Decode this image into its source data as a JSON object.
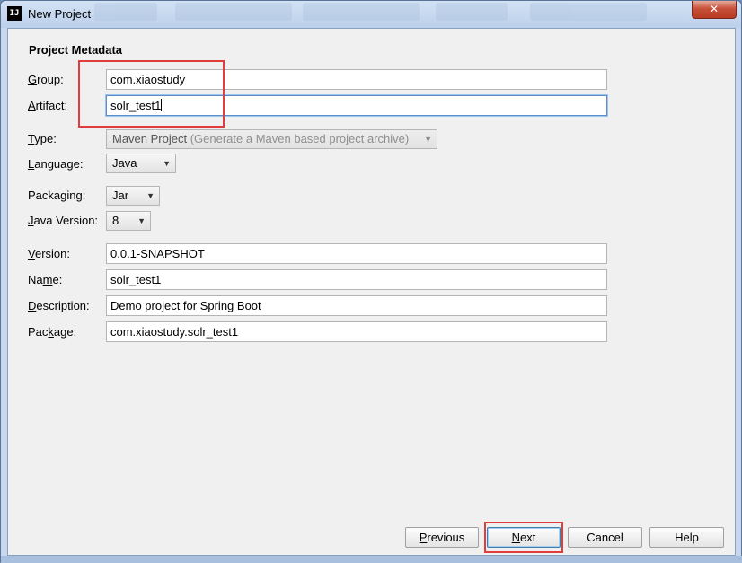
{
  "window": {
    "title": "New Project",
    "app_icon": "IJ",
    "close_glyph": "✕"
  },
  "section": {
    "title": "Project Metadata"
  },
  "fields": {
    "group": {
      "label_pre": "",
      "label_u": "G",
      "label_post": "roup:",
      "value": "com.xiaostudy"
    },
    "artifact": {
      "label_pre": "",
      "label_u": "A",
      "label_post": "rtifact:",
      "value": "solr_test1"
    },
    "type": {
      "label_pre": "",
      "label_u": "T",
      "label_post": "ype:",
      "value": "Maven Project",
      "hint": "(Generate a Maven based project archive)"
    },
    "language": {
      "label_pre": "",
      "label_u": "L",
      "label_post": "anguage:",
      "value": "Java"
    },
    "packaging": {
      "label_pre": "Packa",
      "label_u": "g",
      "label_post": "ing:",
      "value": "Jar"
    },
    "java_version": {
      "label_pre": "",
      "label_u": "J",
      "label_post": "ava Version:",
      "value": "8"
    },
    "version": {
      "label_pre": "",
      "label_u": "V",
      "label_post": "ersion:",
      "value": "0.0.1-SNAPSHOT"
    },
    "name": {
      "label_pre": "Na",
      "label_u": "m",
      "label_post": "e:",
      "value": "solr_test1"
    },
    "description": {
      "label_pre": "",
      "label_u": "D",
      "label_post": "escription:",
      "value": "Demo project for Spring Boot"
    },
    "package": {
      "label_pre": "Pac",
      "label_u": "k",
      "label_post": "age:",
      "value": "com.xiaostudy.solr_test1"
    }
  },
  "buttons": {
    "previous": {
      "pre": "",
      "u": "P",
      "post": "revious"
    },
    "next": {
      "pre": "",
      "u": "N",
      "post": "ext"
    },
    "cancel": {
      "label": "Cancel"
    },
    "help": {
      "label": "Help"
    }
  },
  "icons": {
    "dropdown": "chevron-down-icon",
    "close": "close-icon",
    "app": "intellij-icon"
  },
  "colors": {
    "highlight_box": "#e03d3d",
    "focus_border": "#5b8fc9",
    "title_bar": "#c7d8ee"
  }
}
